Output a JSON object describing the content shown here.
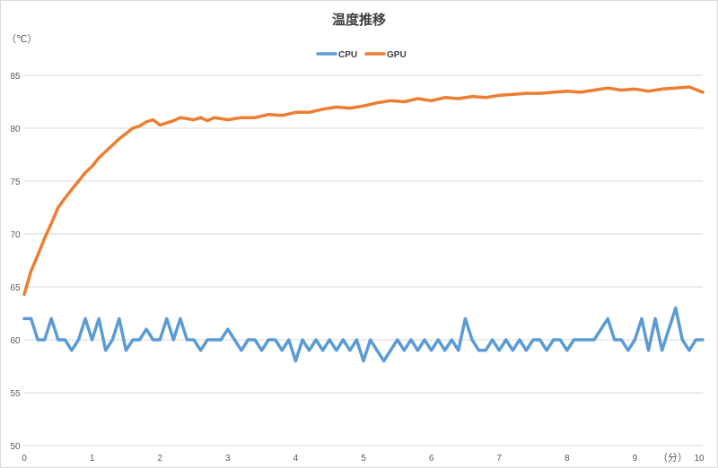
{
  "chart_data": {
    "type": "line",
    "title": "温度推移",
    "y_unit": "（℃）",
    "x_unit": "（分）",
    "xlim": [
      0,
      10
    ],
    "ylim": [
      50,
      85
    ],
    "x_ticks": [
      0,
      1,
      2,
      3,
      4,
      5,
      6,
      7,
      8,
      9,
      10
    ],
    "y_ticks": [
      50,
      55,
      60,
      65,
      70,
      75,
      80,
      85
    ],
    "grid": "horizontal",
    "legend_position": "top",
    "colors": {
      "CPU": "#5b9bd5",
      "GPU": "#ed7d31"
    },
    "series": [
      {
        "name": "CPU",
        "x": [
          0,
          0.1,
          0.2,
          0.3,
          0.4,
          0.5,
          0.6,
          0.7,
          0.8,
          0.9,
          1.0,
          1.1,
          1.2,
          1.3,
          1.4,
          1.5,
          1.6,
          1.7,
          1.8,
          1.9,
          2.0,
          2.1,
          2.2,
          2.3,
          2.4,
          2.5,
          2.6,
          2.7,
          2.8,
          2.9,
          3.0,
          3.1,
          3.2,
          3.3,
          3.4,
          3.5,
          3.6,
          3.7,
          3.8,
          3.9,
          4.0,
          4.1,
          4.2,
          4.3,
          4.4,
          4.5,
          4.6,
          4.7,
          4.8,
          4.9,
          5.0,
          5.1,
          5.2,
          5.3,
          5.4,
          5.5,
          5.6,
          5.7,
          5.8,
          5.9,
          6.0,
          6.1,
          6.2,
          6.3,
          6.4,
          6.5,
          6.6,
          6.7,
          6.8,
          6.9,
          7.0,
          7.1,
          7.2,
          7.3,
          7.4,
          7.5,
          7.6,
          7.7,
          7.8,
          7.9,
          8.0,
          8.1,
          8.2,
          8.3,
          8.4,
          8.5,
          8.6,
          8.7,
          8.8,
          8.9,
          9.0,
          9.1,
          9.2,
          9.3,
          9.4,
          9.5,
          9.6,
          9.7,
          9.8,
          9.9,
          10.0
        ],
        "values": [
          62,
          62,
          60,
          60,
          62,
          60,
          60,
          59,
          60,
          62,
          60,
          62,
          59,
          60,
          62,
          59,
          60,
          60,
          61,
          60,
          60,
          62,
          60,
          62,
          60,
          60,
          59,
          60,
          60,
          60,
          61,
          60,
          59,
          60,
          60,
          59,
          60,
          60,
          59,
          60,
          58,
          60,
          59,
          60,
          59,
          60,
          59,
          60,
          59,
          60,
          58,
          60,
          59,
          58,
          59,
          60,
          59,
          60,
          59,
          60,
          59,
          60,
          59,
          60,
          59,
          62,
          60,
          59,
          59,
          60,
          59,
          60,
          59,
          60,
          59,
          60,
          60,
          59,
          60,
          60,
          59,
          60,
          60,
          60,
          60,
          61,
          62,
          60,
          60,
          59,
          60,
          62,
          59,
          62,
          59,
          61,
          63,
          60,
          59,
          60,
          60
        ]
      },
      {
        "name": "GPU",
        "x": [
          0,
          0.1,
          0.2,
          0.3,
          0.4,
          0.5,
          0.6,
          0.7,
          0.8,
          0.9,
          1.0,
          1.1,
          1.2,
          1.3,
          1.4,
          1.5,
          1.6,
          1.7,
          1.8,
          1.9,
          2.0,
          2.1,
          2.2,
          2.3,
          2.4,
          2.5,
          2.6,
          2.7,
          2.8,
          2.9,
          3.0,
          3.2,
          3.4,
          3.6,
          3.8,
          4.0,
          4.2,
          4.4,
          4.6,
          4.8,
          5.0,
          5.2,
          5.4,
          5.6,
          5.8,
          6.0,
          6.2,
          6.4,
          6.6,
          6.8,
          7.0,
          7.2,
          7.4,
          7.6,
          7.8,
          8.0,
          8.2,
          8.4,
          8.6,
          8.8,
          9.0,
          9.2,
          9.4,
          9.6,
          9.8,
          10.0
        ],
        "values": [
          64.3,
          66.5,
          68.0,
          69.6,
          71.0,
          72.5,
          73.4,
          74.2,
          75.0,
          75.8,
          76.4,
          77.2,
          77.8,
          78.4,
          79.0,
          79.5,
          80.0,
          80.2,
          80.6,
          80.8,
          80.3,
          80.5,
          80.7,
          81.0,
          80.9,
          80.8,
          81.0,
          80.7,
          81.0,
          80.9,
          80.8,
          81.0,
          81.0,
          81.3,
          81.2,
          81.5,
          81.5,
          81.8,
          82.0,
          81.9,
          82.1,
          82.4,
          82.6,
          82.5,
          82.8,
          82.6,
          82.9,
          82.8,
          83.0,
          82.9,
          83.1,
          83.2,
          83.3,
          83.3,
          83.4,
          83.5,
          83.4,
          83.6,
          83.8,
          83.6,
          83.7,
          83.5,
          83.7,
          83.8,
          83.9,
          83.4
        ]
      }
    ]
  }
}
